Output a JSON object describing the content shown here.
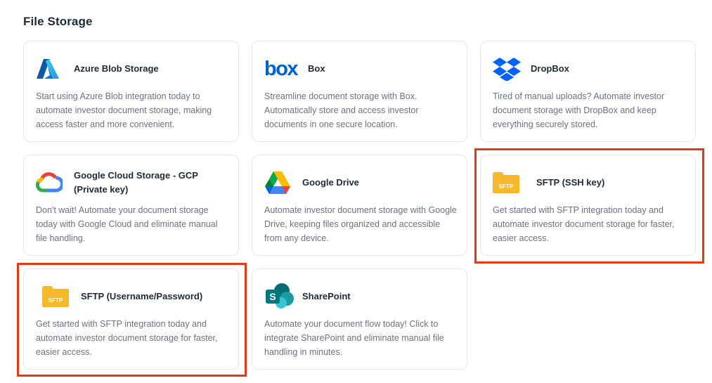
{
  "section": {
    "title": "File Storage"
  },
  "cards": [
    {
      "name": "Azure Blob Storage",
      "description": "Start using Azure Blob integration today to automate investor document storage, making access faster and more convenient.",
      "icon": "azure-icon"
    },
    {
      "name": "Box",
      "description": "Streamline document storage with Box. Automatically store and access investor documents in one secure location.",
      "icon": "box-logo-icon",
      "logo_text": "box"
    },
    {
      "name": "DropBox",
      "description": "Tired of manual uploads? Automate investor document storage with DropBox and keep everything securely stored.",
      "icon": "dropbox-icon"
    },
    {
      "name": "Google Cloud Storage - GCP (Private key)",
      "description": "Don't wait! Automate your document storage today with Google Cloud and eliminate manual file handling.",
      "icon": "google-cloud-icon"
    },
    {
      "name": "Google Drive",
      "description": "Automate investor document storage with Google Drive, keeping files organized and accessible from any device.",
      "icon": "google-drive-icon"
    },
    {
      "name": "SFTP (SSH key)",
      "description": "Get started with SFTP integration today and automate investor document storage for faster, easier access.",
      "icon": "sftp-folder-icon",
      "logo_text": "SFTP"
    },
    {
      "name": "SFTP (Username/Password)",
      "description": "Get started with SFTP integration today and automate investor document storage for faster, easier access.",
      "icon": "sftp-folder-icon",
      "logo_text": "SFTP"
    },
    {
      "name": "SharePoint",
      "description": "Automate your document flow today! Click to integrate SharePoint and eliminate manual file handling in minutes.",
      "icon": "sharepoint-icon",
      "logo_text": "S"
    }
  ],
  "colors": {
    "highlight": "#e23b12",
    "box_blue": "#0061d5",
    "dropbox_blue": "#0061fe",
    "sftp_folder": "#f5b92a"
  }
}
